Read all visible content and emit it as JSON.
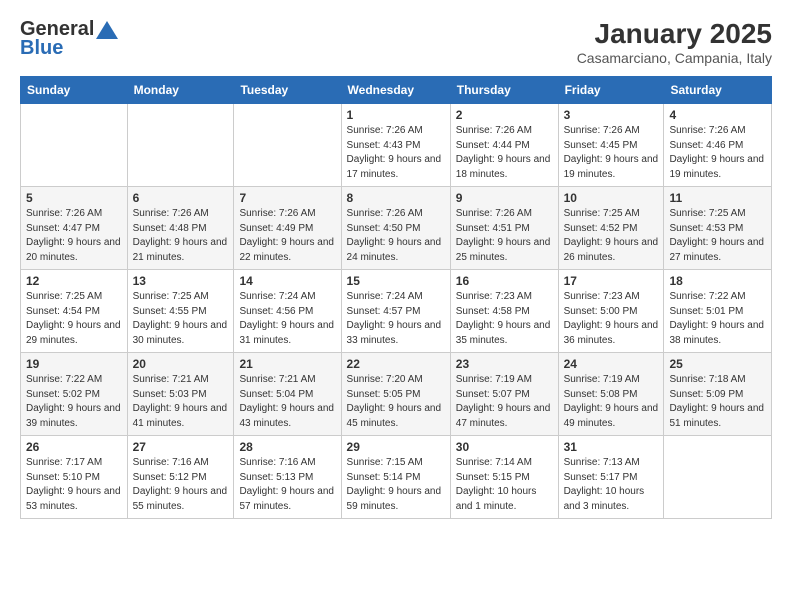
{
  "logo": {
    "general": "General",
    "blue": "Blue"
  },
  "header": {
    "month": "January 2025",
    "location": "Casamarciano, Campania, Italy"
  },
  "weekdays": [
    "Sunday",
    "Monday",
    "Tuesday",
    "Wednesday",
    "Thursday",
    "Friday",
    "Saturday"
  ],
  "weeks": [
    [
      {
        "day": "",
        "sunrise": "",
        "sunset": "",
        "daylight": ""
      },
      {
        "day": "",
        "sunrise": "",
        "sunset": "",
        "daylight": ""
      },
      {
        "day": "",
        "sunrise": "",
        "sunset": "",
        "daylight": ""
      },
      {
        "day": "1",
        "sunrise": "Sunrise: 7:26 AM",
        "sunset": "Sunset: 4:43 PM",
        "daylight": "Daylight: 9 hours and 17 minutes."
      },
      {
        "day": "2",
        "sunrise": "Sunrise: 7:26 AM",
        "sunset": "Sunset: 4:44 PM",
        "daylight": "Daylight: 9 hours and 18 minutes."
      },
      {
        "day": "3",
        "sunrise": "Sunrise: 7:26 AM",
        "sunset": "Sunset: 4:45 PM",
        "daylight": "Daylight: 9 hours and 19 minutes."
      },
      {
        "day": "4",
        "sunrise": "Sunrise: 7:26 AM",
        "sunset": "Sunset: 4:46 PM",
        "daylight": "Daylight: 9 hours and 19 minutes."
      }
    ],
    [
      {
        "day": "5",
        "sunrise": "Sunrise: 7:26 AM",
        "sunset": "Sunset: 4:47 PM",
        "daylight": "Daylight: 9 hours and 20 minutes."
      },
      {
        "day": "6",
        "sunrise": "Sunrise: 7:26 AM",
        "sunset": "Sunset: 4:48 PM",
        "daylight": "Daylight: 9 hours and 21 minutes."
      },
      {
        "day": "7",
        "sunrise": "Sunrise: 7:26 AM",
        "sunset": "Sunset: 4:49 PM",
        "daylight": "Daylight: 9 hours and 22 minutes."
      },
      {
        "day": "8",
        "sunrise": "Sunrise: 7:26 AM",
        "sunset": "Sunset: 4:50 PM",
        "daylight": "Daylight: 9 hours and 24 minutes."
      },
      {
        "day": "9",
        "sunrise": "Sunrise: 7:26 AM",
        "sunset": "Sunset: 4:51 PM",
        "daylight": "Daylight: 9 hours and 25 minutes."
      },
      {
        "day": "10",
        "sunrise": "Sunrise: 7:25 AM",
        "sunset": "Sunset: 4:52 PM",
        "daylight": "Daylight: 9 hours and 26 minutes."
      },
      {
        "day": "11",
        "sunrise": "Sunrise: 7:25 AM",
        "sunset": "Sunset: 4:53 PM",
        "daylight": "Daylight: 9 hours and 27 minutes."
      }
    ],
    [
      {
        "day": "12",
        "sunrise": "Sunrise: 7:25 AM",
        "sunset": "Sunset: 4:54 PM",
        "daylight": "Daylight: 9 hours and 29 minutes."
      },
      {
        "day": "13",
        "sunrise": "Sunrise: 7:25 AM",
        "sunset": "Sunset: 4:55 PM",
        "daylight": "Daylight: 9 hours and 30 minutes."
      },
      {
        "day": "14",
        "sunrise": "Sunrise: 7:24 AM",
        "sunset": "Sunset: 4:56 PM",
        "daylight": "Daylight: 9 hours and 31 minutes."
      },
      {
        "day": "15",
        "sunrise": "Sunrise: 7:24 AM",
        "sunset": "Sunset: 4:57 PM",
        "daylight": "Daylight: 9 hours and 33 minutes."
      },
      {
        "day": "16",
        "sunrise": "Sunrise: 7:23 AM",
        "sunset": "Sunset: 4:58 PM",
        "daylight": "Daylight: 9 hours and 35 minutes."
      },
      {
        "day": "17",
        "sunrise": "Sunrise: 7:23 AM",
        "sunset": "Sunset: 5:00 PM",
        "daylight": "Daylight: 9 hours and 36 minutes."
      },
      {
        "day": "18",
        "sunrise": "Sunrise: 7:22 AM",
        "sunset": "Sunset: 5:01 PM",
        "daylight": "Daylight: 9 hours and 38 minutes."
      }
    ],
    [
      {
        "day": "19",
        "sunrise": "Sunrise: 7:22 AM",
        "sunset": "Sunset: 5:02 PM",
        "daylight": "Daylight: 9 hours and 39 minutes."
      },
      {
        "day": "20",
        "sunrise": "Sunrise: 7:21 AM",
        "sunset": "Sunset: 5:03 PM",
        "daylight": "Daylight: 9 hours and 41 minutes."
      },
      {
        "day": "21",
        "sunrise": "Sunrise: 7:21 AM",
        "sunset": "Sunset: 5:04 PM",
        "daylight": "Daylight: 9 hours and 43 minutes."
      },
      {
        "day": "22",
        "sunrise": "Sunrise: 7:20 AM",
        "sunset": "Sunset: 5:05 PM",
        "daylight": "Daylight: 9 hours and 45 minutes."
      },
      {
        "day": "23",
        "sunrise": "Sunrise: 7:19 AM",
        "sunset": "Sunset: 5:07 PM",
        "daylight": "Daylight: 9 hours and 47 minutes."
      },
      {
        "day": "24",
        "sunrise": "Sunrise: 7:19 AM",
        "sunset": "Sunset: 5:08 PM",
        "daylight": "Daylight: 9 hours and 49 minutes."
      },
      {
        "day": "25",
        "sunrise": "Sunrise: 7:18 AM",
        "sunset": "Sunset: 5:09 PM",
        "daylight": "Daylight: 9 hours and 51 minutes."
      }
    ],
    [
      {
        "day": "26",
        "sunrise": "Sunrise: 7:17 AM",
        "sunset": "Sunset: 5:10 PM",
        "daylight": "Daylight: 9 hours and 53 minutes."
      },
      {
        "day": "27",
        "sunrise": "Sunrise: 7:16 AM",
        "sunset": "Sunset: 5:12 PM",
        "daylight": "Daylight: 9 hours and 55 minutes."
      },
      {
        "day": "28",
        "sunrise": "Sunrise: 7:16 AM",
        "sunset": "Sunset: 5:13 PM",
        "daylight": "Daylight: 9 hours and 57 minutes."
      },
      {
        "day": "29",
        "sunrise": "Sunrise: 7:15 AM",
        "sunset": "Sunset: 5:14 PM",
        "daylight": "Daylight: 9 hours and 59 minutes."
      },
      {
        "day": "30",
        "sunrise": "Sunrise: 7:14 AM",
        "sunset": "Sunset: 5:15 PM",
        "daylight": "Daylight: 10 hours and 1 minute."
      },
      {
        "day": "31",
        "sunrise": "Sunrise: 7:13 AM",
        "sunset": "Sunset: 5:17 PM",
        "daylight": "Daylight: 10 hours and 3 minutes."
      },
      {
        "day": "",
        "sunrise": "",
        "sunset": "",
        "daylight": ""
      }
    ]
  ]
}
